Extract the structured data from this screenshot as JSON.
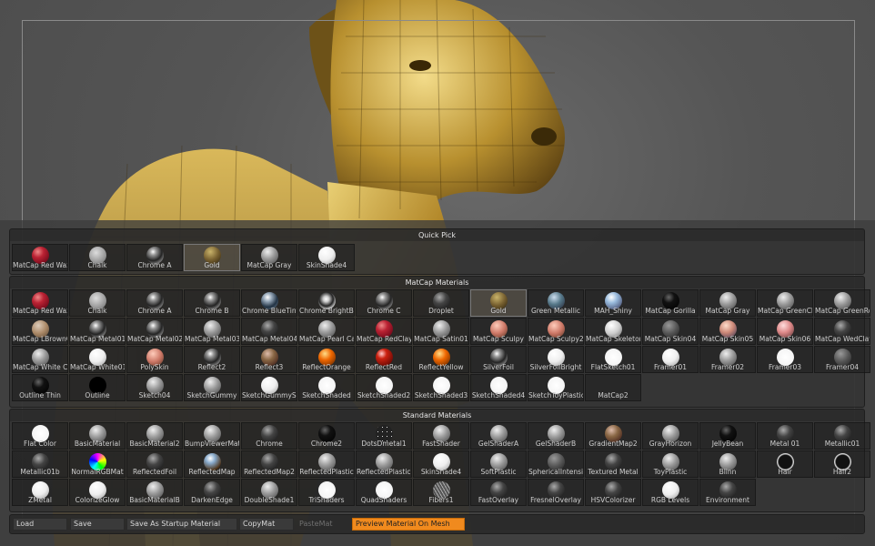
{
  "colors": {
    "accent": "#f08a1e",
    "panel_bg": "#303030"
  },
  "quick_pick": {
    "title": "Quick Pick",
    "items": [
      {
        "label": "MatCap Red Wax",
        "style": "red"
      },
      {
        "label": "Chalk",
        "style": "chalk"
      },
      {
        "label": "Chrome A",
        "style": "chrome"
      },
      {
        "label": "Gold",
        "style": "gold",
        "selected": true
      },
      {
        "label": "MatCap Gray",
        "style": "gray"
      },
      {
        "label": "SkinShade4",
        "style": "white"
      }
    ]
  },
  "matcap": {
    "title": "MatCap Materials",
    "items": [
      {
        "label": "MatCap Red Wax",
        "style": "red"
      },
      {
        "label": "Chalk",
        "style": "chalk"
      },
      {
        "label": "Chrome A",
        "style": "chrome"
      },
      {
        "label": "Chrome B",
        "style": "chrome"
      },
      {
        "label": "Chrome BlueTint",
        "style": "chromeblue"
      },
      {
        "label": "Chrome BrightBlue",
        "style": "chromebright"
      },
      {
        "label": "Chrome C",
        "style": "chrome"
      },
      {
        "label": "Droplet",
        "style": "dark"
      },
      {
        "label": "Gold",
        "style": "gold",
        "selected": true
      },
      {
        "label": "Green Metallic",
        "style": "bluegreen"
      },
      {
        "label": "MAH_Shiny",
        "style": "bluewhite"
      },
      {
        "label": "MatCap Gorilla",
        "style": "black"
      },
      {
        "label": "MatCap Gray",
        "style": "gray"
      },
      {
        "label": "MatCap GreenClay",
        "style": "gray"
      },
      {
        "label": "MatCap GreenRoof",
        "style": "gray"
      },
      {
        "label": "MatCap LBrownClay",
        "style": "tan"
      },
      {
        "label": "MatCap Metal01",
        "style": "chrome"
      },
      {
        "label": "MatCap Metal02",
        "style": "chrome"
      },
      {
        "label": "MatCap Metal03",
        "style": "gray"
      },
      {
        "label": "MatCap Metal04",
        "style": "dark"
      },
      {
        "label": "MatCap Pearl Cavity",
        "style": "gray"
      },
      {
        "label": "MatCap RedClay",
        "style": "red"
      },
      {
        "label": "MatCap Satin01",
        "style": "gray"
      },
      {
        "label": "MatCap Sculpy",
        "style": "salmon"
      },
      {
        "label": "MatCap Sculpy2",
        "style": "salmon"
      },
      {
        "label": "MatCap Skeleton",
        "style": "bone"
      },
      {
        "label": "MatCap Skin04",
        "style": "darkgray"
      },
      {
        "label": "MatCap Skin05",
        "style": "skinblue"
      },
      {
        "label": "MatCap Skin06",
        "style": "skinred"
      },
      {
        "label": "MatCap WedClay",
        "style": "dark"
      },
      {
        "label": "MatCap White Cavity",
        "style": "gray"
      },
      {
        "label": "MatCap White01",
        "style": "white"
      },
      {
        "label": "PolySkin",
        "style": "salmon"
      },
      {
        "label": "Reflect2",
        "style": "chrome"
      },
      {
        "label": "Reflect3",
        "style": "bronze"
      },
      {
        "label": "ReflectOrange",
        "style": "orange"
      },
      {
        "label": "ReflectRed",
        "style": "redshiny"
      },
      {
        "label": "ReflectYellow",
        "style": "orange"
      },
      {
        "label": "SilverFoil",
        "style": "chrome"
      },
      {
        "label": "SilverFoilBright",
        "style": "white"
      },
      {
        "label": "FlatSketch01",
        "style": "flatwhite"
      },
      {
        "label": "Framer01",
        "style": "white"
      },
      {
        "label": "Framer02",
        "style": "gray"
      },
      {
        "label": "Framer03",
        "style": "flatwhite"
      },
      {
        "label": "Framer04",
        "style": "darkgray"
      },
      {
        "label": "Outline Thin",
        "style": "black"
      },
      {
        "label": "Outline",
        "style": "outline"
      },
      {
        "label": "Sketch04",
        "style": "gray"
      },
      {
        "label": "SketchGummy",
        "style": "gray"
      },
      {
        "label": "SketchGummyShaded",
        "style": "white"
      },
      {
        "label": "SketchShaded",
        "style": "flatwhite"
      },
      {
        "label": "SketchShaded2",
        "style": "flatwhite"
      },
      {
        "label": "SketchShaded3",
        "style": "flatwhite"
      },
      {
        "label": "SketchShaded4",
        "style": "flatwhite"
      },
      {
        "label": "SketchToyPlastic",
        "style": "flatwhite"
      },
      {
        "label": "MatCap2",
        "style": "none"
      }
    ]
  },
  "standard": {
    "title": "Standard Materials",
    "items": [
      {
        "label": "Flat Color",
        "style": "flatwhite"
      },
      {
        "label": "BasicMaterial",
        "style": "gray"
      },
      {
        "label": "BasicMaterial2",
        "style": "gray"
      },
      {
        "label": "BumpViewerMaterial",
        "style": "gray"
      },
      {
        "label": "Chrome",
        "style": "dark"
      },
      {
        "label": "Chrome2",
        "style": "black"
      },
      {
        "label": "DotsDmetal1",
        "style": "dots"
      },
      {
        "label": "FastShader",
        "style": "gray"
      },
      {
        "label": "GelShaderA",
        "style": "gray"
      },
      {
        "label": "GelShaderB",
        "style": "gray"
      },
      {
        "label": "GradientMap2",
        "style": "bronze"
      },
      {
        "label": "GrayHorizon",
        "style": "gray"
      },
      {
        "label": "JellyBean",
        "style": "black"
      },
      {
        "label": "Metal 01",
        "style": "dark"
      },
      {
        "label": "Metallic01",
        "style": "dark"
      },
      {
        "label": "Metallic01b",
        "style": "dark"
      },
      {
        "label": "NormalRGBMat",
        "style": "rgb"
      },
      {
        "label": "ReflectedFoil",
        "style": "dark"
      },
      {
        "label": "ReflectedMap",
        "style": "sky"
      },
      {
        "label": "ReflectedMap2",
        "style": "dark"
      },
      {
        "label": "ReflectedPlastic",
        "style": "gray"
      },
      {
        "label": "ReflectedPlasticB",
        "style": "gray"
      },
      {
        "label": "SkinShade4",
        "style": "white"
      },
      {
        "label": "SoftPlastic",
        "style": "gray"
      },
      {
        "label": "SphericalIntensity",
        "style": "darkgray"
      },
      {
        "label": "Textured Metal",
        "style": "dark"
      },
      {
        "label": "ToyPlastic",
        "style": "gray"
      },
      {
        "label": "Blinn",
        "style": "gray"
      },
      {
        "label": "Hair",
        "style": "ring"
      },
      {
        "label": "Hair2",
        "style": "ring"
      },
      {
        "label": "ZMetal",
        "style": "white"
      },
      {
        "label": "ColorizeGlow",
        "style": "white"
      },
      {
        "label": "BasicMaterialB",
        "style": "gray"
      },
      {
        "label": "DarkenEdge",
        "style": "dark"
      },
      {
        "label": "DoubleShade1",
        "style": "gray"
      },
      {
        "label": "TriShaders",
        "style": "flatwhite"
      },
      {
        "label": "QuadShaders",
        "style": "flatwhite"
      },
      {
        "label": "Fibers1",
        "style": "fibers"
      },
      {
        "label": "FastOverlay",
        "style": "dark"
      },
      {
        "label": "FresnelOverlay",
        "style": "dark"
      },
      {
        "label": "HSVColorizer",
        "style": "dark"
      },
      {
        "label": "RGB Levels",
        "style": "white"
      },
      {
        "label": "Environment",
        "style": "dark"
      }
    ]
  },
  "buttons": {
    "load": "Load",
    "save": "Save",
    "save_startup": "Save As Startup Material",
    "copymat": "CopyMat",
    "pastemat": "PasteMat",
    "preview": "Preview Material On Mesh"
  }
}
